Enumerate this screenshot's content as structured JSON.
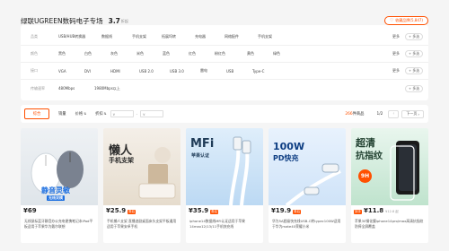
{
  "header": {
    "store_name": "绿联UGREEN数码电子专场",
    "rating": "3.7",
    "rating_label": "折起",
    "follow_label": "收藏品牌(5,847)"
  },
  "filters": [
    {
      "label": "品类",
      "options": [
        "USB/HUB转换器",
        "数据线",
        "手机支架",
        "拓展坞转",
        "充电器",
        "网络配件",
        "手机支架"
      ],
      "more": "更多",
      "multi": "+ 多选"
    },
    {
      "label": "颜色",
      "options": [
        "黑色",
        "白色",
        "灰色",
        "米色",
        "蓝色",
        "红色",
        "粉红色",
        "黄色",
        "绿色"
      ],
      "more": "更多",
      "multi": "+ 多选"
    },
    {
      "label": "接口",
      "options": [
        "VGA",
        "DVI",
        "HDMI",
        "USB 2.0",
        "USB 3.0",
        "雷电",
        "USB",
        "Type-C"
      ],
      "more": "更多",
      "multi": "+ 多选"
    },
    {
      "label": "传输速率",
      "options": [
        "480Mbps",
        "1980Mbps以上"
      ],
      "more": "",
      "multi": "+ 多选"
    }
  ],
  "sort": {
    "tabs": [
      "综合",
      "销量",
      "价格",
      "折扣"
    ],
    "price_from": "¥",
    "price_to": "¥",
    "result_count": "266",
    "result_suffix": "件商品",
    "page": "1/2",
    "prev": "‹",
    "next": "下一页"
  },
  "products": [
    {
      "price": "¥69",
      "tag": "",
      "orig": "",
      "title": "无线鼠标蓝牙静音办公充电便携笔记本iPad平板适用于苹果华为戴尔联想",
      "img_text": [
        "静音灵敏",
        "无线双模"
      ],
      "img_sub": ""
    },
    {
      "price": "¥25.9",
      "tag": "券后",
      "orig": "",
      "title": "手机懒人支架 直播追剧桌面床头支架平板通用适用于苹果安卓手机",
      "img_text": [
        "懒人",
        "手机支架"
      ],
      "img_sub": ""
    },
    {
      "price": "¥35.9",
      "tag": "券后",
      "orig": "",
      "title": "iphone14数据线MFi认证适用于苹果14max12/13/11手机快充线",
      "img_text": [
        "MFi",
        "苹果认证"
      ],
      "img_sub": ""
    },
    {
      "price": "¥19.9",
      "tag": "券后",
      "orig": "",
      "title": "华为5A超级快充线USB-C转typec100W适用于华为mate40荣耀小米",
      "img_text": [
        "100W",
        "PD快充"
      ],
      "img_sub": ""
    },
    {
      "price": "¥11.8",
      "tag": "到手",
      "orig": "¥12.8 起",
      "title": "苹果30钢化膜iphone14pro/max高清抗指纹防摔全屏覆盖",
      "img_text": [
        "超清",
        "抗指纹"
      ],
      "img_sub": "9H"
    }
  ],
  "colors": {
    "accent": "#ff5000"
  }
}
